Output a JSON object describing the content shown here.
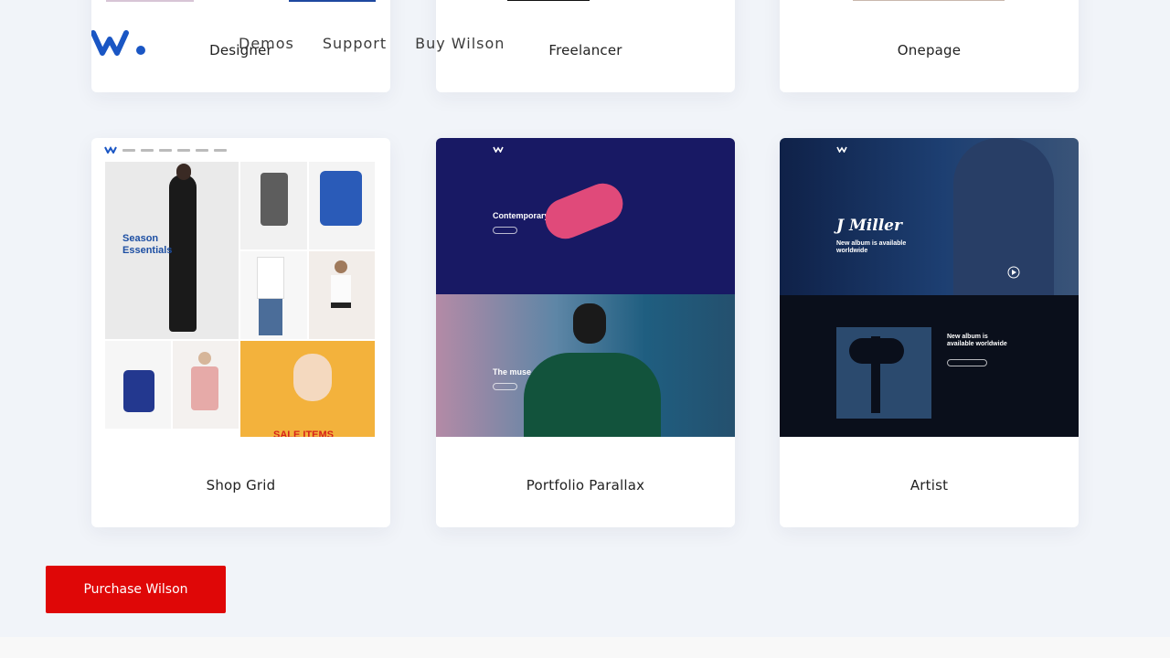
{
  "header": {
    "logo_icon": "wilson-w-logo",
    "nav": [
      "Demos",
      "Support",
      "Buy Wilson"
    ]
  },
  "demos_top": [
    {
      "label": "Designer"
    },
    {
      "label": "Freelancer"
    },
    {
      "label": "Onepage"
    }
  ],
  "demos_bottom": [
    {
      "label": "Shop Grid",
      "preview": {
        "headline": "Season Essentials",
        "promo": "SALE ITEMS"
      }
    },
    {
      "label": "Portfolio Parallax",
      "preview": {
        "section1": "Contemporary",
        "section2": "The muse"
      }
    },
    {
      "label": "Artist",
      "preview": {
        "name": "J Miller",
        "tagline": "New album is available worldwide",
        "album_text": "New album is available worldwide"
      }
    }
  ],
  "cta": {
    "label": "Purchase Wilson"
  },
  "colors": {
    "accent_red": "#df0707",
    "logo_blue": "#1a56c4",
    "page_bg": "#f1f4f9"
  }
}
